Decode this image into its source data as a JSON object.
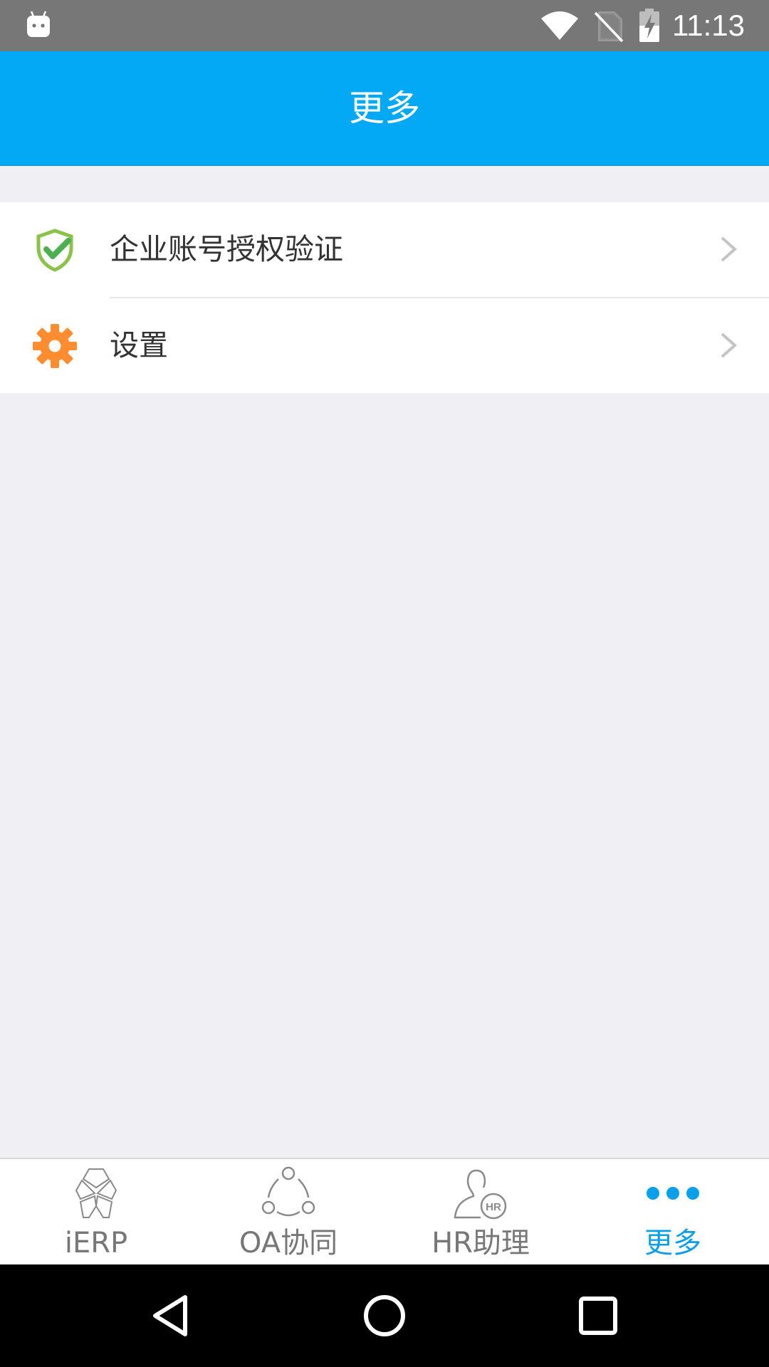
{
  "status_bar": {
    "time": "11:13",
    "icons": [
      "android-icon",
      "wifi-icon",
      "no-sim-icon",
      "battery-charging-icon"
    ]
  },
  "header": {
    "title": "更多"
  },
  "menu": {
    "items": [
      {
        "label": "企业账号授权验证",
        "icon": "shield-check-icon",
        "color": "#8bc34a"
      },
      {
        "label": "设置",
        "icon": "gear-icon",
        "color": "#ff8c2e"
      }
    ]
  },
  "tab_bar": {
    "tabs": [
      {
        "label": "iERP",
        "icon": "hexagon-petals-icon",
        "active": false
      },
      {
        "label": "OA协同",
        "icon": "collaboration-circle-icon",
        "active": false
      },
      {
        "label": "HR助理",
        "icon": "hr-person-icon",
        "active": false
      },
      {
        "label": "更多",
        "icon": "more-dots-icon",
        "active": true
      }
    ],
    "active_color": "#0aa0e9",
    "inactive_color": "#777777"
  },
  "nav_bar": {
    "buttons": [
      "back-icon",
      "home-icon",
      "recents-icon"
    ]
  },
  "colors": {
    "header_bg": "#03a9f4",
    "status_bg": "#777777",
    "page_bg": "#efeff4"
  }
}
